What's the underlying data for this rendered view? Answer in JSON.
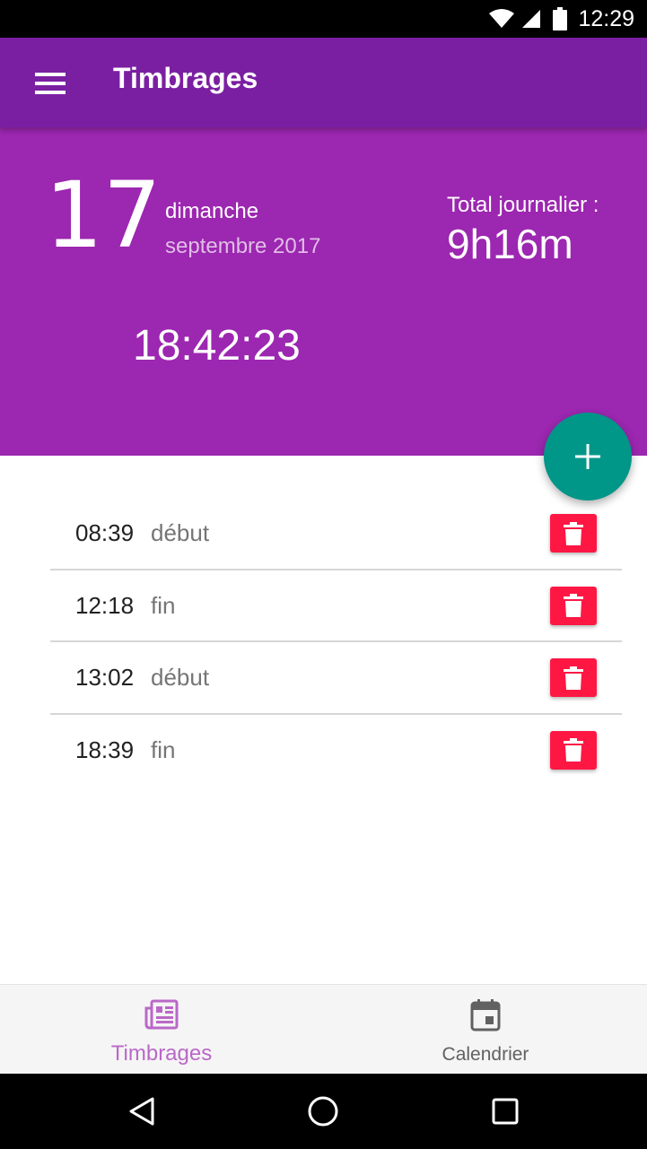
{
  "status_bar": {
    "time": "12:29",
    "icons": [
      "wifi-icon",
      "cell-signal-icon",
      "battery-icon"
    ]
  },
  "app_bar": {
    "title": "Timbrages",
    "menu_icon": "hamburger-menu-icon"
  },
  "header": {
    "day": "17",
    "weekday": "dimanche",
    "month_year": "septembre 2017",
    "total_label": "Total journalier :",
    "total_value": "9h16m",
    "current_time": "18:42:23"
  },
  "fab": {
    "icon": "plus-icon"
  },
  "entries": [
    {
      "time": "08:39",
      "type": "début"
    },
    {
      "time": "12:18",
      "type": "fin"
    },
    {
      "time": "13:02",
      "type": "début"
    },
    {
      "time": "18:39",
      "type": "fin"
    }
  ],
  "bottom_nav": {
    "items": [
      {
        "label": "Timbrages",
        "icon": "newspaper-icon",
        "active": true
      },
      {
        "label": "Calendrier",
        "icon": "calendar-icon",
        "active": false
      }
    ]
  },
  "system_nav": {
    "buttons": [
      "back-triangle-icon",
      "home-circle-icon",
      "recents-square-icon"
    ]
  },
  "colors": {
    "app_bar": "#7b1fa2",
    "header": "#9c27b0",
    "fab": "#009688",
    "delete": "#ff1744",
    "nav_active": "#ba68c8",
    "nav_inactive": "#616161"
  }
}
